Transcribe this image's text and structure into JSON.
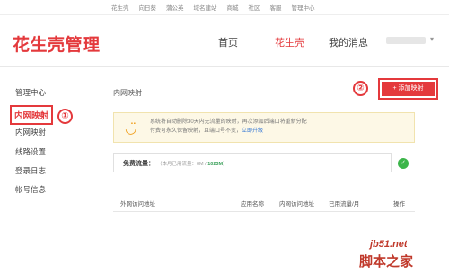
{
  "top_links": [
    "花生壳",
    "向日葵",
    "蒲公英",
    "域名建站",
    "商城",
    "社区",
    "客服",
    "管理中心"
  ],
  "brand": {
    "title": "花生壳管理",
    "accent": "#e4393c"
  },
  "nav": {
    "home": "首页",
    "hsk": "花生壳",
    "messages": "我的消息"
  },
  "sidebar": {
    "items": [
      {
        "label": "管理中心"
      },
      {
        "label": "内网映射"
      },
      {
        "label": "内网映射"
      },
      {
        "label": "线路设置"
      },
      {
        "label": "登录日志"
      },
      {
        "label": "帐号信息"
      }
    ]
  },
  "annotations": {
    "one": "①",
    "two": "②"
  },
  "main": {
    "title": "内网映射",
    "add_button": "+ 添加映射",
    "notice": {
      "icon": "smiley-icon",
      "text": "系统将自动删除30天内无流量的映射，再次添加后端口将重新分配",
      "text2": "付费可永久保留映射，且端口号不变，",
      "link": "立即升级"
    },
    "traffic": {
      "label": "免费流量：",
      "detail_prefix": "（本月已用流量：0M / ",
      "detail_value": "1023M",
      "detail_suffix": "）"
    },
    "table_headers": [
      "外网访问地址",
      "应用名称",
      "内网访问地址",
      "已用流量/月",
      "操作"
    ]
  },
  "watermark": {
    "site": "jb51.net",
    "name": "脚本之家"
  }
}
